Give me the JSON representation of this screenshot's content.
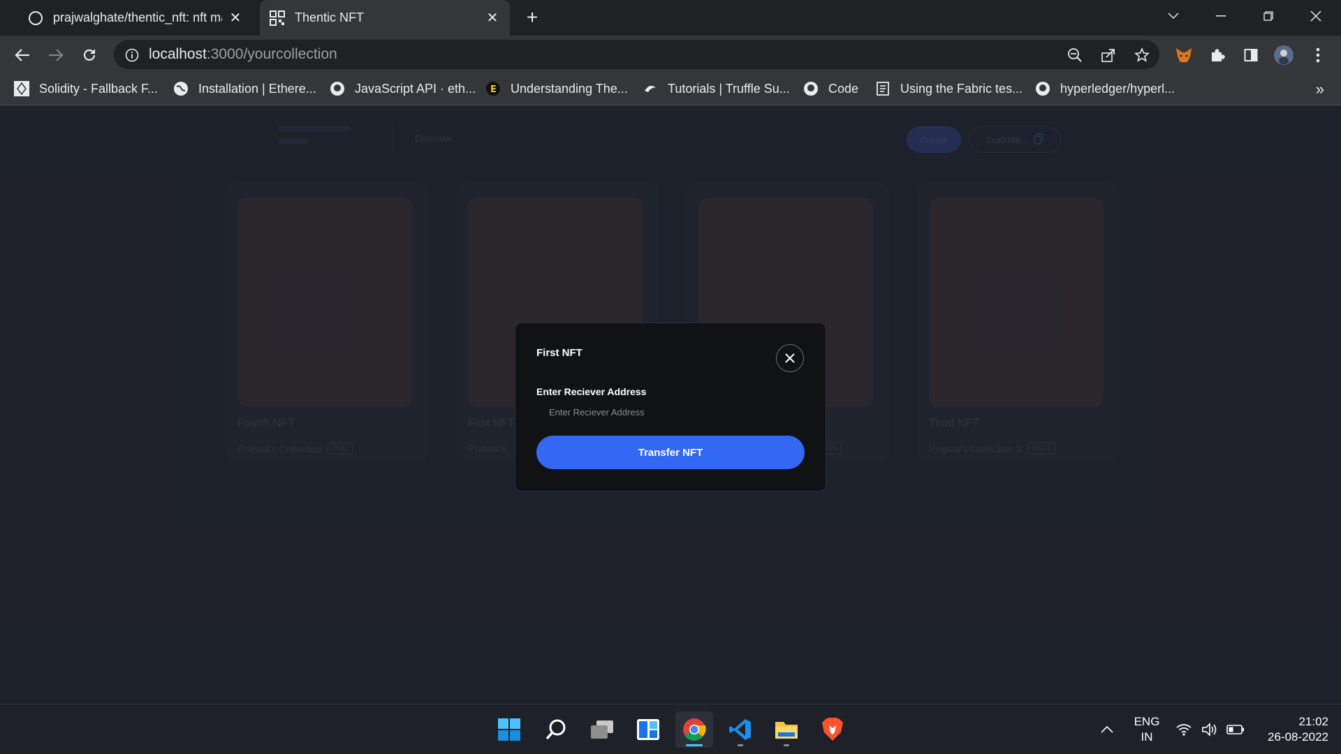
{
  "browser": {
    "tabs": [
      {
        "title": "prajwalghate/thentic_nft: nft mar",
        "icon": "github-icon",
        "active": false
      },
      {
        "title": "Thentic NFT",
        "icon": "qr-icon",
        "active": true
      }
    ],
    "url_host": "localhost",
    "url_path": ":3000/yourcollection",
    "bookmarks": [
      {
        "label": "Solidity - Fallback F...",
        "icon": "solidity-icon"
      },
      {
        "label": "Installation | Ethere...",
        "icon": "globe-icon"
      },
      {
        "label": "JavaScript API · eth...",
        "icon": "github-icon"
      },
      {
        "label": "Understanding The...",
        "icon": "e-logo-icon"
      },
      {
        "label": "Tutorials | Truffle Su...",
        "icon": "truffle-icon"
      },
      {
        "label": "Code",
        "icon": "github-icon"
      },
      {
        "label": "Using the Fabric tes...",
        "icon": "doc-icon"
      },
      {
        "label": "hyperledger/hyperl...",
        "icon": "github-icon"
      }
    ],
    "bookmarks_more": "»"
  },
  "site": {
    "discover": "Discover",
    "create": "Create",
    "wallet": "0xa9368..."
  },
  "cards": [
    {
      "name": "Fourth NFT",
      "collection": "Prajwal's Collection",
      "symbol": "PGC"
    },
    {
      "name": "First NFT",
      "collection": "Prajwal's",
      "symbol": ""
    },
    {
      "name": "",
      "collection": "",
      "symbol": "C3"
    },
    {
      "name": "Third NFT",
      "collection": "Prajwal's Collection 3",
      "symbol": "PGC3"
    }
  ],
  "modal": {
    "title": "First NFT",
    "label": "Enter Reciever Address",
    "placeholder": "Enter Reciever Address",
    "value": "",
    "button": "Transfer NFT"
  },
  "taskbar": {
    "apps": [
      "windows-start-icon",
      "search-icon",
      "task-view-icon",
      "widgets-icon",
      "chrome-icon",
      "vscode-icon",
      "file-explorer-icon",
      "brave-icon"
    ],
    "lang_line1": "ENG",
    "lang_line2": "IN",
    "time": "21:02",
    "date": "26-08-2022"
  }
}
